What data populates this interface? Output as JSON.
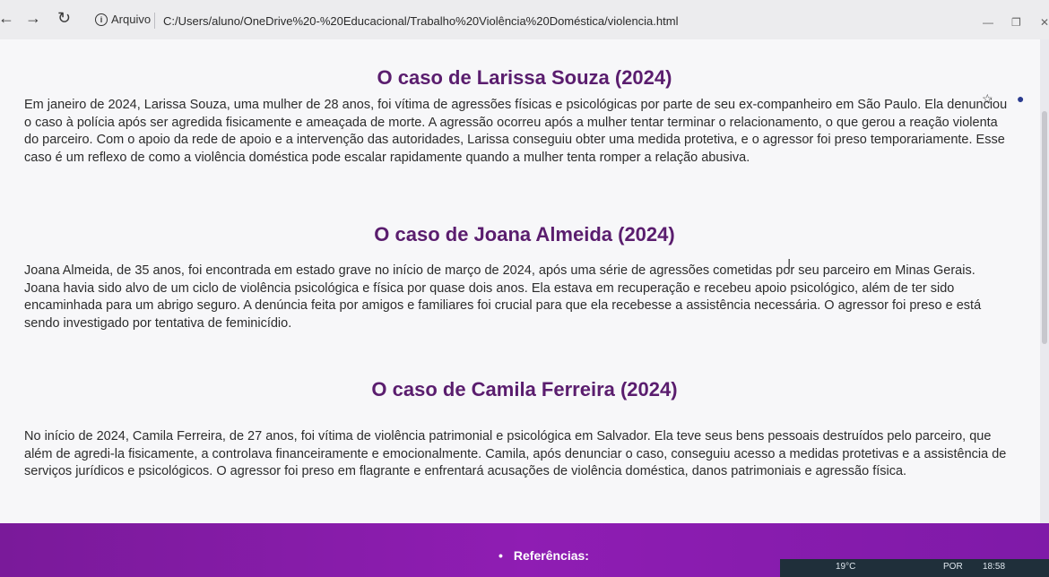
{
  "browser": {
    "back_icon": "back-arrow-icon",
    "forward_icon": "forward-arrow-icon",
    "reload_icon": "reload-icon",
    "info_label": "Arquivo",
    "url": "C:/Users/aluno/OneDrive%20-%20Educacional/Trabalho%20Violência%20Doméstica/violencia.html"
  },
  "cases": [
    {
      "title": "O caso de Larissa Souza (2024)",
      "text": "Em janeiro de 2024, Larissa Souza, uma mulher de 28 anos, foi vítima de agressões físicas e psicológicas por parte de seu ex-companheiro em São Paulo. Ela denunciou o caso à polícia após ser agredida fisicamente e ameaçada de morte. A agressão ocorreu após a mulher tentar terminar o relacionamento, o que gerou a reação violenta do parceiro. Com o apoio da rede de apoio e a intervenção das autoridades, Larissa conseguiu obter uma medida protetiva, e o agressor foi preso temporariamente. Esse caso é um reflexo de como a violência doméstica pode escalar rapidamente quando a mulher tenta romper a relação abusiva."
    },
    {
      "title": "O caso de Joana Almeida (2024)",
      "text": "Joana Almeida, de 35 anos, foi encontrada em estado grave no início de março de 2024, após uma série de agressões cometidas por seu parceiro em Minas Gerais. Joana havia sido alvo de um ciclo de violência psicológica e física por quase dois anos. Ela estava em recuperação e recebeu apoio psicológico, além de ter sido encaminhada para um abrigo seguro. A denúncia feita por amigos e familiares foi crucial para que ela recebesse a assistência necessária. O agressor foi preso e está sendo investigado por tentativa de feminicídio."
    },
    {
      "title": "O caso de Camila Ferreira (2024)",
      "text": "No início de 2024, Camila Ferreira, de 27 anos, foi vítima de violência patrimonial e psicológica em Salvador. Ela teve seus bens pessoais destruídos pelo parceiro, que além de agredi-la fisicamente, a controlava financeiramente e emocionalmente. Camila, após denunciar o caso, conseguiu acesso a medidas protetivas e a assistência de serviços jurídicos e psicológicos. O agressor foi preso em flagrante e enfrentará acusações de violência doméstica, danos patrimoniais e agressão física."
    }
  ],
  "footer": {
    "references_label": "Referências:"
  },
  "taskbar": {
    "temp": "19°C",
    "lang": "POR",
    "time": "18:58"
  },
  "colors": {
    "heading": "#5a1d6e",
    "footer": "#8f1db3"
  }
}
